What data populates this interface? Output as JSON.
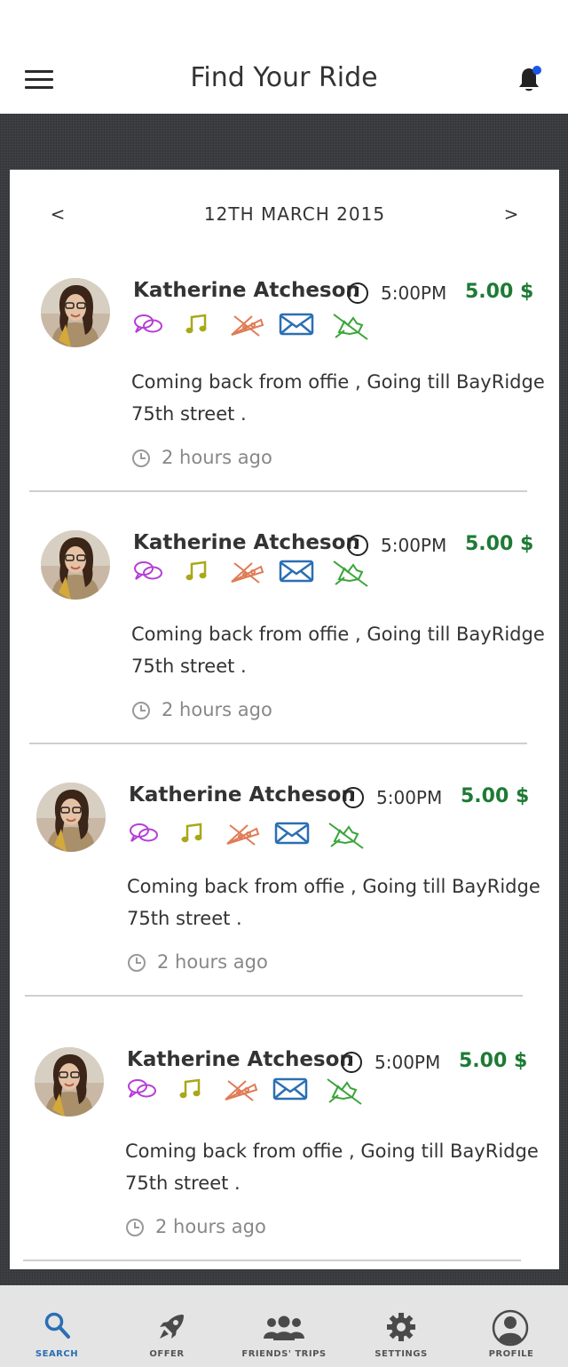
{
  "header": {
    "title": "Find Your Ride",
    "menu_icon": "hamburger-icon",
    "bell_icon": "bell-icon",
    "notification_dot_color": "#1a56e8"
  },
  "date_nav": {
    "prev": "<",
    "date": "12TH MARCH 2015",
    "next": ">"
  },
  "rides": [
    {
      "name": "Katherine Atcheson",
      "time": "5:00PM",
      "price": "5.00 $",
      "description": "Coming back from offie , Going till BayRidge 75th street .",
      "ago": "2 hours ago"
    },
    {
      "name": "Katherine Atcheson",
      "time": "5:00PM",
      "price": "5.00 $",
      "description": "Coming back from offie , Going till BayRidge 75th street .",
      "ago": "2 hours ago"
    },
    {
      "name": "Katherine Atcheson",
      "time": "5:00PM",
      "price": "5.00 $",
      "description": "Coming back from offie , Going till BayRidge 75th street .",
      "ago": "2 hours ago"
    },
    {
      "name": "Katherine Atcheson",
      "time": "5:00PM",
      "price": "5.00 $",
      "description": "Coming back from offie , Going till BayRidge 75th street .",
      "ago": "2 hours ago"
    }
  ],
  "amenities": [
    {
      "icon": "chat-icon",
      "color": "#b53fd6"
    },
    {
      "icon": "music-icon",
      "color": "#a8a81a"
    },
    {
      "icon": "no-food-icon",
      "color": "#e07b55"
    },
    {
      "icon": "mail-icon",
      "color": "#2a6fb3"
    },
    {
      "icon": "no-pets-icon",
      "color": "#3aa53a"
    }
  ],
  "colors": {
    "price": "#1e7a35",
    "active_tab": "#2a6fb3",
    "panel": "#3a3c3f"
  },
  "tabs": [
    {
      "label": "SEARCH",
      "icon": "search-icon",
      "active": true
    },
    {
      "label": "OFFER",
      "icon": "rocket-icon",
      "active": false
    },
    {
      "label": "FRIENDS' TRIPS",
      "icon": "friends-icon",
      "active": false
    },
    {
      "label": "SETTINGS",
      "icon": "gear-icon",
      "active": false
    },
    {
      "label": "PROFILE",
      "icon": "profile-icon",
      "active": false
    }
  ]
}
